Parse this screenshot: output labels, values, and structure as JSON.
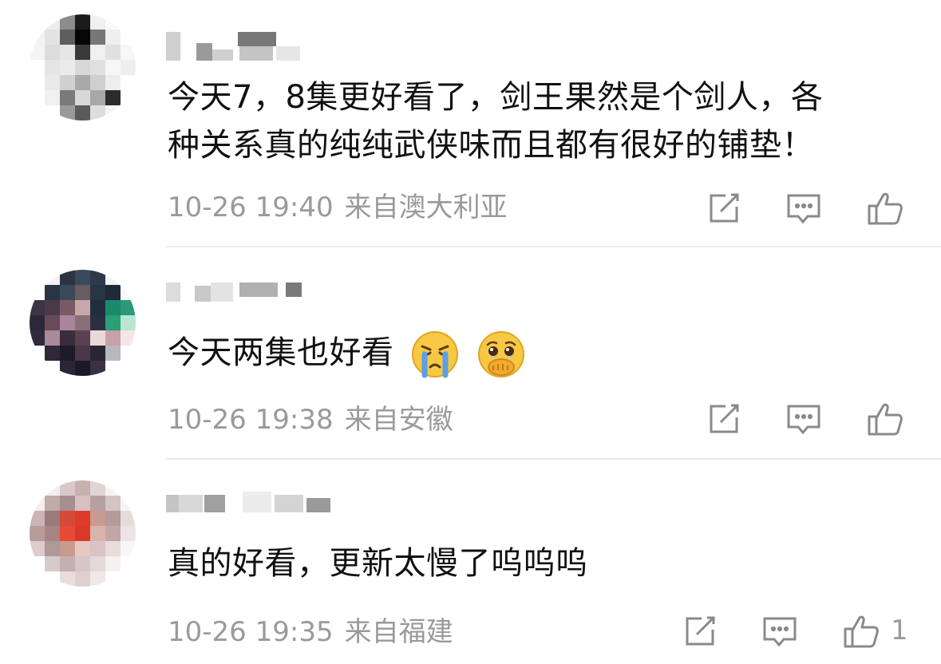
{
  "comments": [
    {
      "text_line1": "今天7，8集更好看了，剑王果然是个剑人，各",
      "text_line2": "种关系真的纯纯武侠味而且都有很好的铺垫！",
      "time": "10-26 19:40",
      "location": "来自澳大利亚",
      "like_count": ""
    },
    {
      "text": "今天两集也好看",
      "emojis": [
        "crying-face-emoji",
        "face-holding-back-tears-emoji"
      ],
      "time": "10-26 19:38",
      "location": "来自安徽",
      "like_count": ""
    },
    {
      "text": "真的好看，更新太慢了呜呜呜",
      "time": "10-26 19:35",
      "location": "来自福建",
      "like_count": "1"
    }
  ],
  "icons": {
    "repost": "share-edit-icon",
    "reply": "comment-icon",
    "like": "thumbs-up-icon"
  },
  "colors": {
    "text": "#111111",
    "meta": "#9a9a9a",
    "divider": "#ececec",
    "icon": "#8a8a8a"
  }
}
